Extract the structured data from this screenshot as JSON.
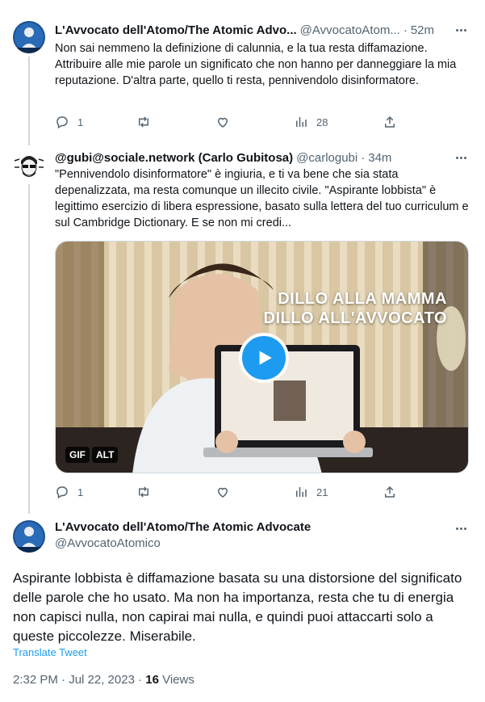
{
  "tweet1": {
    "name": "L'Avvocato dell'Atomo/The Atomic Advo...",
    "handle": "@AvvocatoAtom...",
    "dot": "·",
    "time": "52m",
    "text": "Non sai nemmeno la definizione di calunnia, e la tua resta diffamazione. Attribuire alle mie parole un significato che non hanno per danneggiare la mia reputazione. D'altra parte, quello ti resta, pennivendolo disinformatore.",
    "replies": "1",
    "retweets": "",
    "likes": "",
    "views": "28"
  },
  "tweet2": {
    "name": "@gubi@sociale.network (Carlo Gubitosa)",
    "handle": "@carlogubi",
    "dot": "·",
    "time": "34m",
    "text": "\"Pennivendolo disinformatore\" è ingiuria, e ti va bene che sia stata depenalizzata, ma resta comunque un illecito civile. \"Aspirante lobbista\" è legittimo esercizio di libera espressione, basato sulla lettera del tuo curriculum e sul Cambridge Dictionary. E se non mi credi...",
    "media": {
      "overlay_line1": "DILLO ALLA MAMMA",
      "overlay_line2": "DILLO ALL'AVVOCATO",
      "gif_badge": "GIF",
      "alt_badge": "ALT"
    },
    "replies": "1",
    "retweets": "",
    "likes": "",
    "views": "21"
  },
  "main": {
    "name": "L'Avvocato dell'Atomo/The Atomic Advocate",
    "handle": "@AvvocatoAtomico",
    "text": "Aspirante lobbista è diffamazione basata su una distorsione del significato delle parole che ho usato. Ma non ha importanza, resta che tu di energia non capisci nulla, non capirai mai nulla, e quindi puoi attaccarti solo a queste piccolezze. Miserabile.",
    "translate": "Translate Tweet",
    "date": "2:32 PM · Jul 22, 2023 · ",
    "views_count": "16",
    "views_label": " Views"
  },
  "colors": {
    "accent": "#1d9bf0",
    "secondary_text": "#536471",
    "thread_line": "#cfd9de"
  },
  "icons": [
    "reply-icon",
    "retweet-icon",
    "like-icon",
    "views-icon",
    "share-icon",
    "more-icon",
    "play-icon"
  ]
}
